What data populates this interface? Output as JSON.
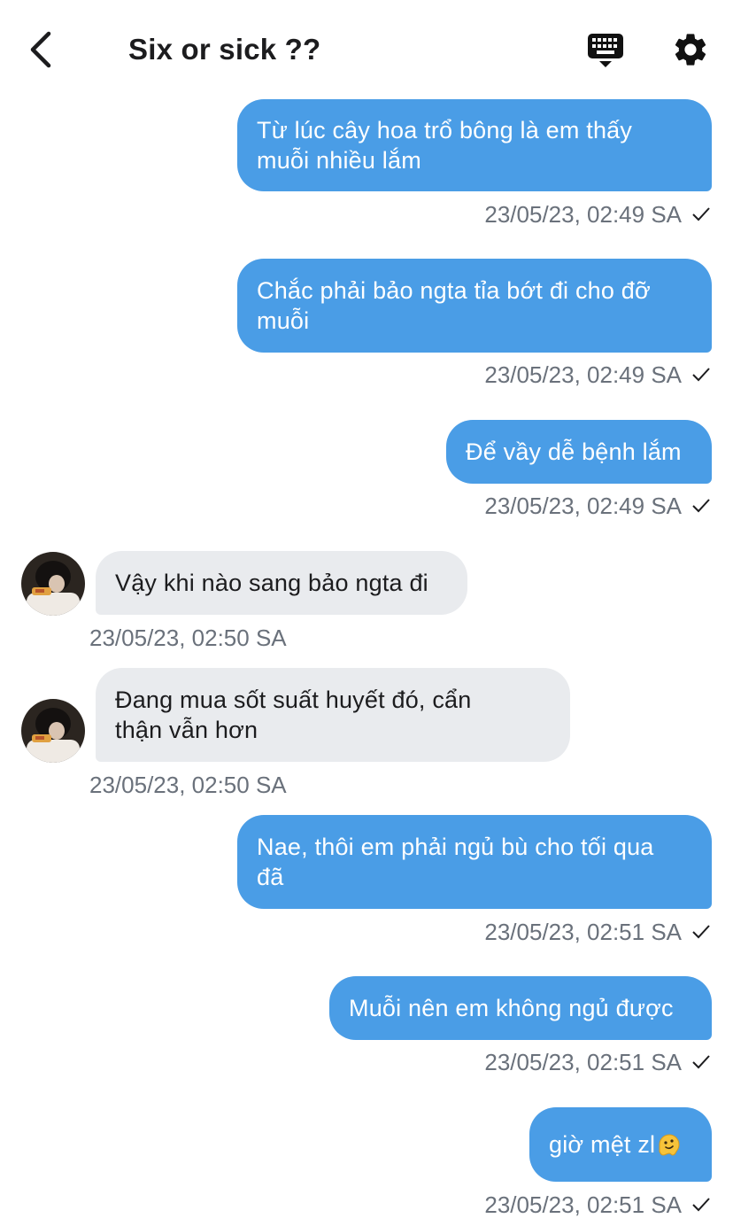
{
  "header": {
    "title": "Six or sick ??",
    "back_icon": "chevron-left-icon",
    "keyboard_icon": "keyboard-icon",
    "settings_icon": "gear-icon"
  },
  "colors": {
    "outgoing_bubble": "#4a9de6",
    "incoming_bubble": "#e9ebee",
    "timestamp": "#6a717b"
  },
  "messages": [
    {
      "dir": "out",
      "lines": [
        "Từ lúc cây hoa trổ bông là em thấy",
        "muỗi nhiều lắm"
      ],
      "time": "23/05/23, 02:49 SA",
      "read": true
    },
    {
      "dir": "out",
      "lines": [
        "Chắc phải bảo ngta tỉa bớt đi cho đỡ",
        "muỗi"
      ],
      "time": "23/05/23, 02:49 SA",
      "read": true
    },
    {
      "dir": "out",
      "lines": [
        "Để vầy dễ bệnh lắm"
      ],
      "time": "23/05/23, 02:49 SA",
      "read": true
    },
    {
      "dir": "in",
      "lines": [
        "Vậy khi nào sang bảo ngta đi"
      ],
      "time": "23/05/23, 02:50 SA"
    },
    {
      "dir": "in",
      "lines": [
        "Đang mua sốt suất huyết đó, cẩn",
        "thận vẫn hơn"
      ],
      "time": "23/05/23, 02:50 SA"
    },
    {
      "dir": "out",
      "lines": [
        "Nae, thôi em phải ngủ bù cho tối qua",
        "đã"
      ],
      "time": "23/05/23, 02:51 SA",
      "read": true
    },
    {
      "dir": "out",
      "lines": [
        "Muỗi nên em không ngủ được"
      ],
      "time": "23/05/23, 02:51 SA",
      "read": true
    },
    {
      "dir": "out",
      "lines": [
        "giờ mệt zl"
      ],
      "emoji": "melting-face-emoji",
      "time": "23/05/23, 02:51 SA",
      "read": true
    }
  ]
}
